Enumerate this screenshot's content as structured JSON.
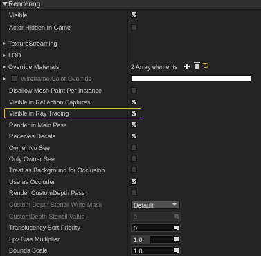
{
  "header": {
    "title": "Rendering"
  },
  "rows": {
    "visible": {
      "label": "Visible",
      "checked": true
    },
    "actor_hidden": {
      "label": "Actor Hidden In Game",
      "checked": false
    },
    "texture_streaming": {
      "label": "TextureStreaming"
    },
    "lod": {
      "label": "LOD"
    },
    "override_materials": {
      "label": "Override Materials",
      "value": "2 Array elements"
    },
    "wireframe_color": {
      "label": "Wireframe Color Override",
      "checked": false,
      "color": "#ffffff"
    },
    "disallow_mesh_paint": {
      "label": "Disallow Mesh Paint Per Instance",
      "checked": false
    },
    "visible_reflection": {
      "label": "Visible in Reflection Captures",
      "checked": true
    },
    "visible_ray_tracing": {
      "label": "Visible in Ray Tracing",
      "checked": true
    },
    "render_main_pass": {
      "label": "Render in Main Pass",
      "checked": true
    },
    "receives_decals": {
      "label": "Receives Decals",
      "checked": true
    },
    "owner_no_see": {
      "label": "Owner No See",
      "checked": false
    },
    "only_owner_see": {
      "label": "Only Owner See",
      "checked": false
    },
    "treat_background": {
      "label": "Treat as Background for Occlusion",
      "checked": false
    },
    "use_occluder": {
      "label": "Use as Occluder",
      "checked": true
    },
    "render_custom_depth": {
      "label": "Render CustomDepth Pass",
      "checked": false
    },
    "stencil_write_mask": {
      "label": "Custom Depth Stencil Write Mask",
      "value": "Default"
    },
    "stencil_value": {
      "label": "CustomDepth Stencil Value",
      "value": "0"
    },
    "translucency_priority": {
      "label": "Translucency Sort Priority",
      "value": "0"
    },
    "lpv_bias": {
      "label": "Lpv Bias Multiplier",
      "value": "1.0",
      "fill_fraction": 0.7
    },
    "bounds_scale": {
      "label": "Bounds Scale",
      "value": "1.0"
    }
  },
  "colors": {
    "highlight": "#d2b94a",
    "reset_arrow": "#c9a62c"
  }
}
